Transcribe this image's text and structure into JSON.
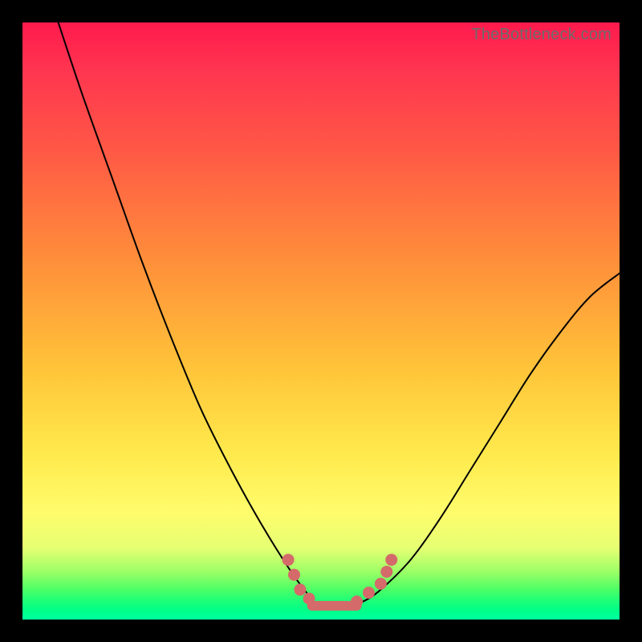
{
  "watermark": "TheBottleneck.com",
  "colors": {
    "frame": "#000000",
    "top": "#ff1a4d",
    "mid": "#ffe94c",
    "bottom": "#00ffa0",
    "curve": "#000000",
    "bead": "#d46a6a"
  },
  "chart_data": {
    "type": "line",
    "title": "",
    "xlabel": "",
    "ylabel": "",
    "xlim": [
      0,
      100
    ],
    "ylim": [
      0,
      100
    ],
    "series": [
      {
        "name": "bottleneck-curve",
        "x": [
          6,
          10,
          15,
          20,
          25,
          30,
          35,
          40,
          45,
          48,
          50,
          52,
          54,
          57,
          60,
          65,
          70,
          75,
          80,
          85,
          90,
          95,
          100
        ],
        "y": [
          100,
          88,
          74,
          60,
          47,
          35,
          25,
          16,
          8,
          4,
          2,
          2,
          2,
          3,
          5,
          10,
          17,
          25,
          33,
          41,
          48,
          54,
          58
        ]
      }
    ],
    "markers": {
      "name": "highlight-beads",
      "points": [
        {
          "x": 44.5,
          "y": 10
        },
        {
          "x": 45.5,
          "y": 7.5
        },
        {
          "x": 46.5,
          "y": 5
        },
        {
          "x": 48,
          "y": 3.5
        },
        {
          "x": 56,
          "y": 3
        },
        {
          "x": 58,
          "y": 4.5
        },
        {
          "x": 60,
          "y": 6
        },
        {
          "x": 61,
          "y": 8
        },
        {
          "x": 61.8,
          "y": 10
        }
      ],
      "bar": {
        "x_start": 48.5,
        "x_end": 56,
        "y": 2.3
      }
    }
  }
}
